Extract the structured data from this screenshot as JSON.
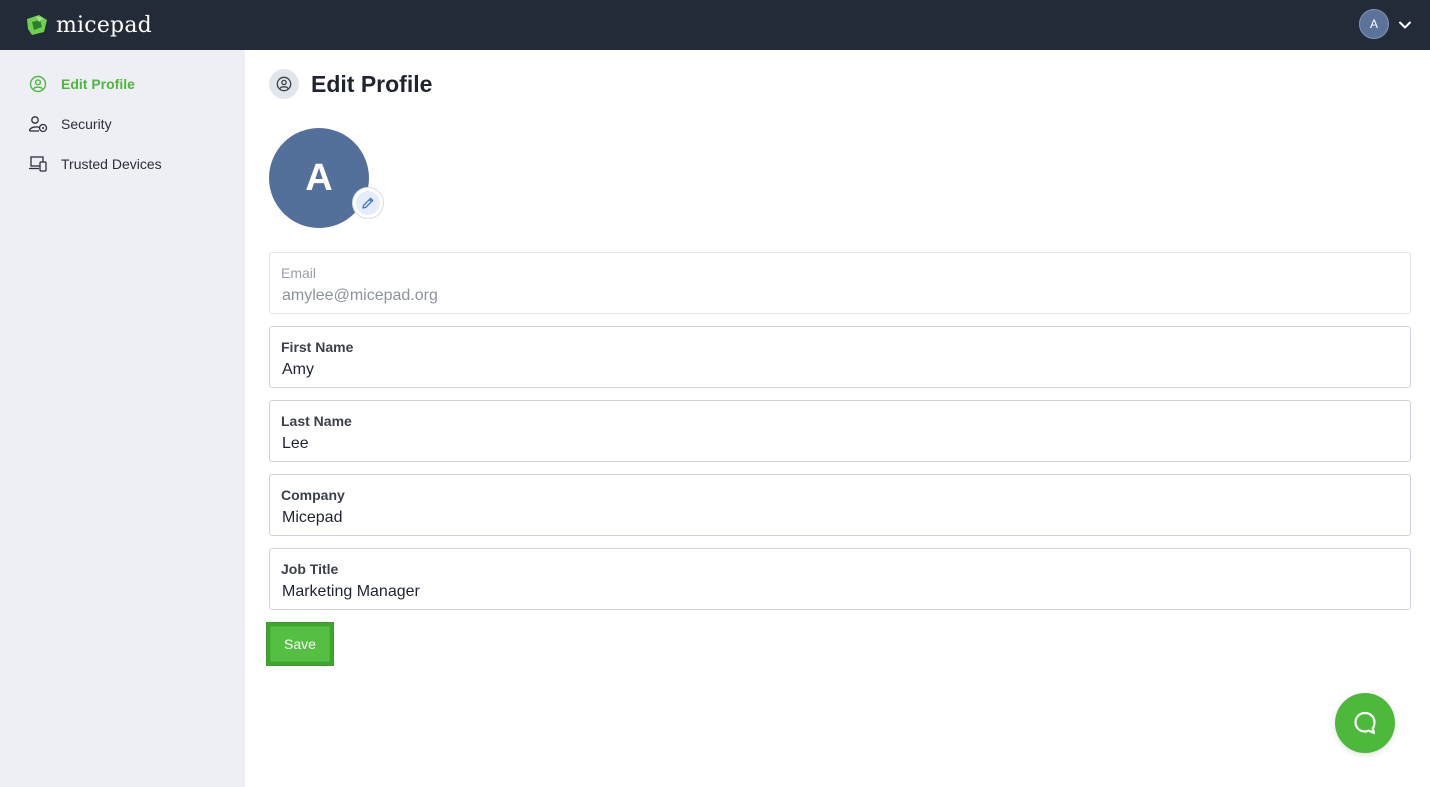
{
  "app": {
    "brand_name": "micepad"
  },
  "header": {
    "user_initial": "A"
  },
  "sidebar": {
    "items": [
      {
        "label": "Edit Profile",
        "icon": "user-circle-icon",
        "active": true
      },
      {
        "label": "Security",
        "icon": "user-shield-icon",
        "active": false
      },
      {
        "label": "Trusted Devices",
        "icon": "devices-icon",
        "active": false
      }
    ]
  },
  "main": {
    "title": "Edit Profile",
    "avatar_initial": "A",
    "fields": {
      "email": {
        "label": "Email",
        "value": "amylee@micepad.org",
        "disabled": true
      },
      "first_name": {
        "label": "First Name",
        "value": "Amy"
      },
      "last_name": {
        "label": "Last Name",
        "value": "Lee"
      },
      "company": {
        "label": "Company",
        "value": "Micepad"
      },
      "job_title": {
        "label": "Job Title",
        "value": "Marketing Manager"
      }
    },
    "save_label": "Save"
  },
  "colors": {
    "topbar": "#232a38",
    "accent": "#4cb93a",
    "sidebar_bg": "#edeff5",
    "avatar_bg": "#52709a"
  }
}
